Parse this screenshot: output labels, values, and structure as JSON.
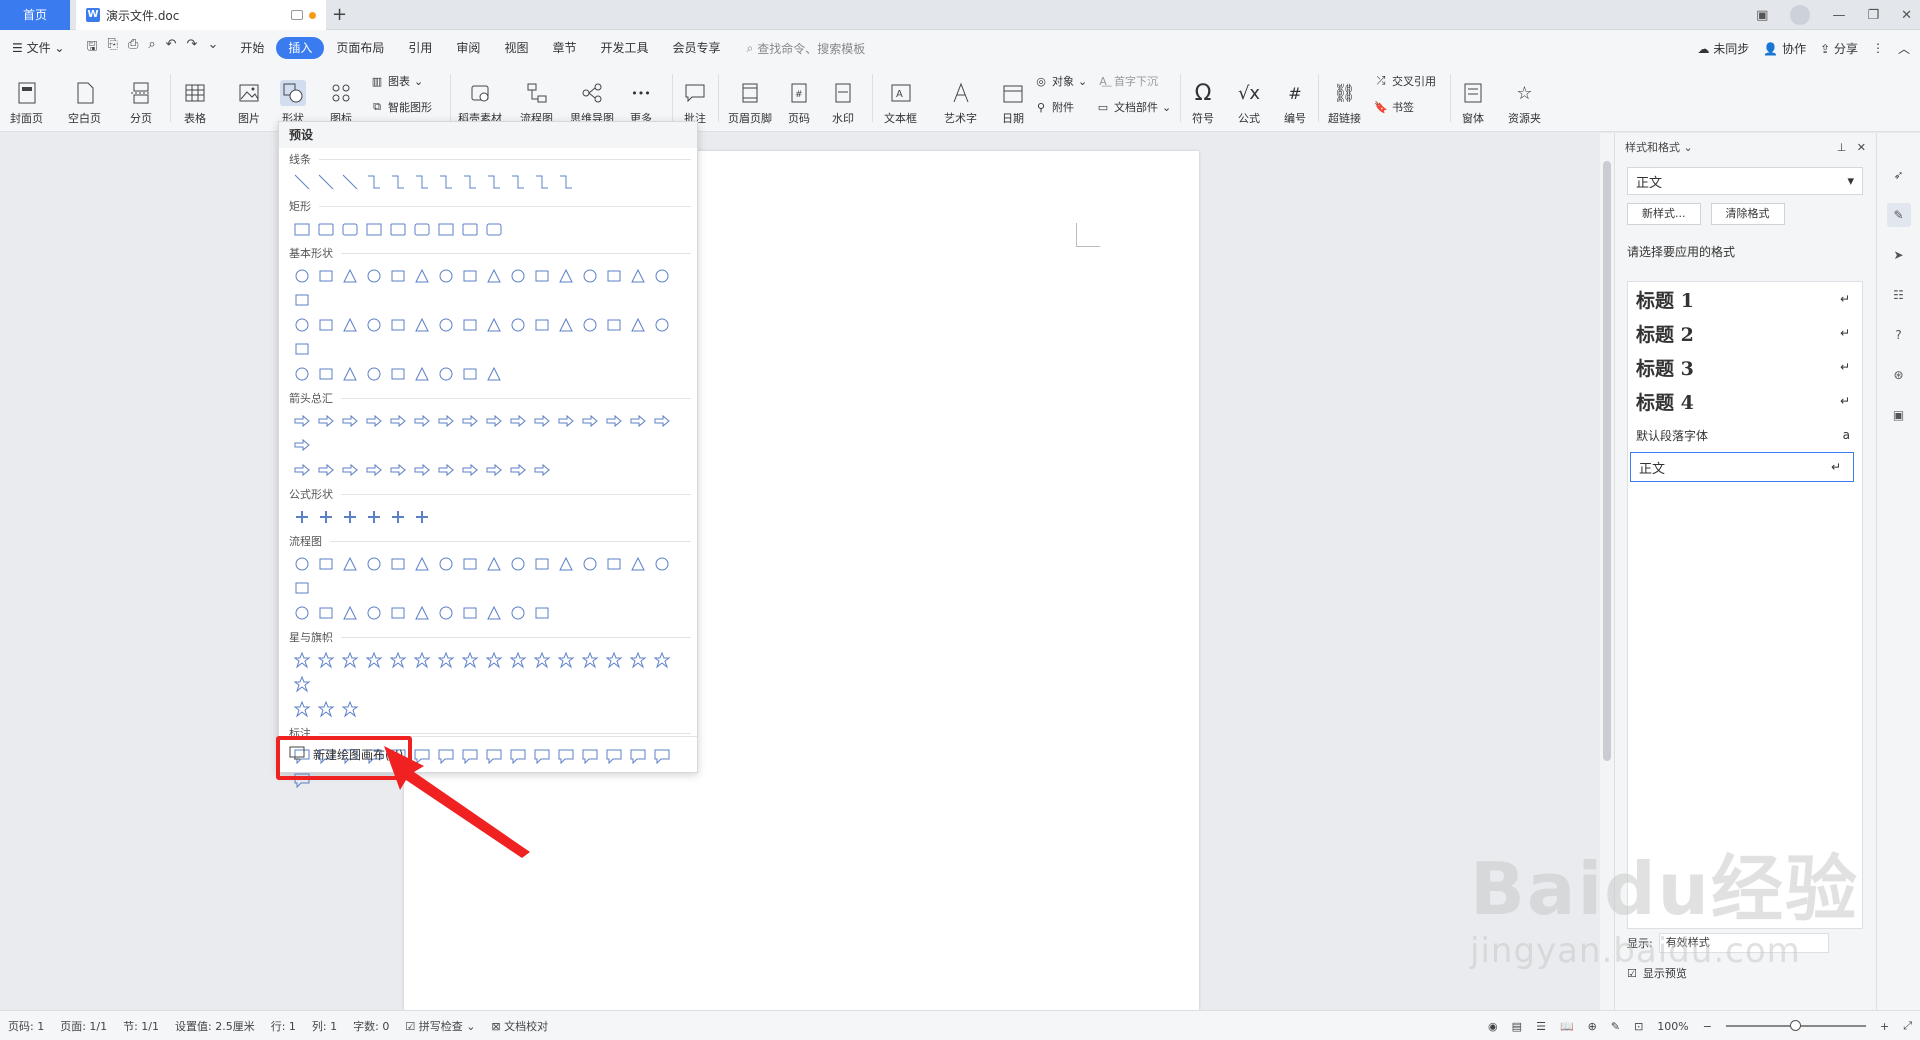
{
  "titlebar": {
    "home_tab": "首页",
    "doc_tab": "演示文件.doc",
    "new_tab": "+"
  },
  "menubar": {
    "file": "文件",
    "tabs": [
      "开始",
      "插入",
      "页面布局",
      "引用",
      "审阅",
      "视图",
      "章节",
      "开发工具",
      "会员专享"
    ],
    "active_tab": "插入",
    "search_placeholder": "查找命令、搜索模板",
    "right": [
      "未同步",
      "协作",
      "分享"
    ]
  },
  "ribbon": {
    "cover": "封面页",
    "blank": "空白页",
    "pagebreak": "分页",
    "table": "表格",
    "picture": "图片",
    "shape": "形状",
    "icon": "图标",
    "chart": "图表",
    "smartart": "智能图形",
    "material": "稻壳素材",
    "flowchart": "流程图",
    "mindmap": "思维导图",
    "more": "更多",
    "comment": "批注",
    "header_footer": "页眉页脚",
    "page_number": "页码",
    "watermark": "水印",
    "textbox": "文本框",
    "wordart": "艺术字",
    "date": "日期",
    "object": "对象",
    "attachment": "附件",
    "dropcap": "首字下沉",
    "docparts": "文档部件",
    "symbol": "符号",
    "formula": "公式",
    "numbering": "编号",
    "hyperlink": "超链接",
    "crossref": "交叉引用",
    "bookmark": "书签",
    "window": "窗体",
    "resource": "资源夹"
  },
  "shapes_menu": {
    "title": "预设",
    "sections": [
      "线条",
      "矩形",
      "基本形状",
      "箭头总汇",
      "公式形状",
      "流程图",
      "星与旗帜",
      "标注"
    ],
    "footer": "新建绘图画布(N)"
  },
  "right_panel": {
    "title": "样式和格式",
    "current_style": "正文",
    "new_style": "新样式...",
    "clear_format": "清除格式",
    "prompt": "请选择要应用的格式",
    "styles": [
      {
        "name": "标题  1",
        "kind": "heading"
      },
      {
        "name": "标题  2",
        "kind": "heading"
      },
      {
        "name": "标题  3",
        "kind": "heading"
      },
      {
        "name": "标题  4",
        "kind": "heading"
      },
      {
        "name": "默认段落字体",
        "kind": "small"
      },
      {
        "name": "正文",
        "kind": "selected"
      }
    ],
    "show_label": "显示:",
    "show_value": "有效样式",
    "preview": "显示预览"
  },
  "statusbar": {
    "page_no": "页码: 1",
    "pages": "页面: 1/1",
    "section": "节: 1/1",
    "setting": "设置值: 2.5厘米",
    "row": "行: 1",
    "col": "列: 1",
    "words": "字数: 0",
    "spell": "拼写检查",
    "proofread": "文档校对",
    "zoom": "100%"
  },
  "watermark": {
    "big": "Baidu经验",
    "sub": "jingyan.baidu.com"
  },
  "colors": {
    "accent": "#3a7bf0",
    "highlight": "#f02121"
  }
}
